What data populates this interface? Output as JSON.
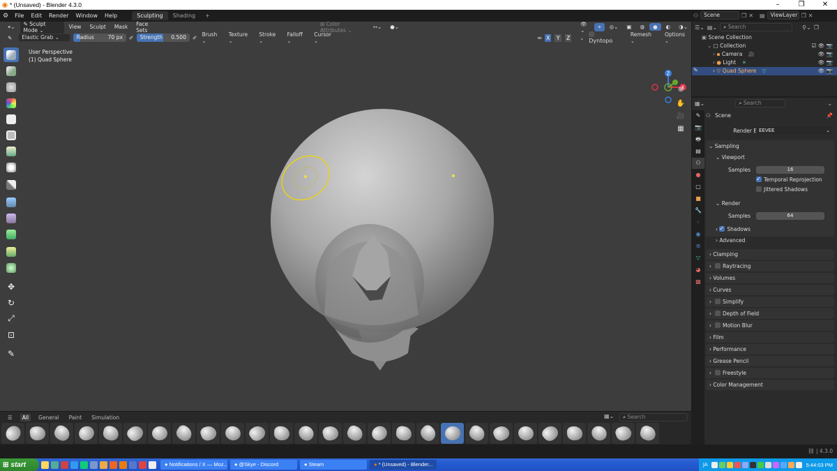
{
  "window": {
    "title": "* (Unsaved) - Blender 4.3.0"
  },
  "menu": {
    "items": [
      "File",
      "Edit",
      "Render",
      "Window",
      "Help"
    ],
    "tabs": [
      "Sculpting",
      "Shading"
    ],
    "add_tab": "+"
  },
  "scene_selector": {
    "scene": "Scene",
    "view_layer": "ViewLayer"
  },
  "viewport_header": {
    "mode": "Sculpt Mode",
    "menus": [
      "View",
      "Sculpt",
      "Mask",
      "Face Sets"
    ],
    "color_attributes": "Color Attributes"
  },
  "tool_settings": {
    "brush_name": "Elastic Grab",
    "radius_label": "Radius",
    "radius_value": "70 px",
    "strength_label": "Strength",
    "strength_value": "0.500",
    "strength_fraction": 0.5,
    "dropdowns": [
      "Brush",
      "Texture",
      "Stroke",
      "Falloff",
      "Cursor"
    ],
    "axes": [
      "X",
      "Y",
      "Z"
    ],
    "dyntopo": "Dyntopo",
    "remesh": "Remesh",
    "options": "Options"
  },
  "viewport_info": {
    "line1": "User Perspective",
    "line2": "(1) Quad Sphere"
  },
  "asset_shelf": {
    "tabs": [
      "All",
      "General",
      "Paint",
      "Simulation"
    ],
    "search_placeholder": "Search",
    "brush_count": 27,
    "selected_index": 18
  },
  "outliner": {
    "search_placeholder": "Search",
    "rows": [
      {
        "label": "Scene Collection",
        "indent": 0
      },
      {
        "label": "Collection",
        "indent": 1
      },
      {
        "label": "Camera",
        "indent": 2
      },
      {
        "label": "Light",
        "indent": 2
      },
      {
        "label": "Quad Sphere",
        "indent": 2
      }
    ]
  },
  "properties": {
    "search_placeholder": "Search",
    "context": "Scene",
    "render_engine_label": "Render Engine",
    "render_engine": "EEVEE",
    "sampling": "Sampling",
    "viewport": "Viewport",
    "samples_label": "Samples",
    "viewport_samples": "16",
    "temporal_reprojection": "Temporal Reprojection",
    "jittered_shadows": "Jittered Shadows",
    "render": "Render",
    "render_samples": "64",
    "shadows": "Shadows",
    "advanced": "Advanced",
    "sections": [
      "Clamping",
      "Raytracing",
      "Volumes",
      "Curves",
      "Simplify",
      "Depth of Field",
      "Motion Blur",
      "Film",
      "Performance",
      "Grease Pencil",
      "Freestyle",
      "Color Management"
    ]
  },
  "status_bar": {
    "version": "4.3.0"
  },
  "taskbar": {
    "start": "start",
    "tasks": [
      "Notifications / X — Moz...",
      "@Skye - Discord",
      "Steam",
      "* (Unsaved) - Blender..."
    ],
    "lang": "JA",
    "clock": "5:44:03 PM"
  },
  "colors": {
    "accent": "#4772b3",
    "viewport_bg": "#3d3d3d",
    "brush_ring": "#e8d21d"
  }
}
